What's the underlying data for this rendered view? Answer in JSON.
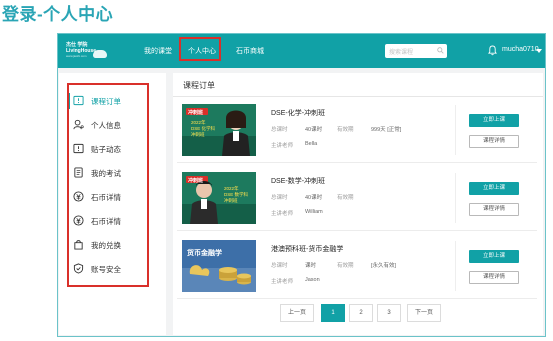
{
  "heading": "登录-个人中心",
  "colors": {
    "accent": "#11a1a6",
    "highlight": "#d9302a"
  },
  "logo": {
    "line1": "杰仕 学院",
    "line2": "LivingHouse",
    "sub": "www.jieshi.com"
  },
  "nav": {
    "items": [
      "我的课堂",
      "个人中心",
      "石币商城"
    ],
    "active": "个人中心"
  },
  "search": {
    "placeholder": "搜索课程"
  },
  "user": {
    "name": "mucha0710"
  },
  "sidebar": {
    "items": [
      {
        "label": "课程订单",
        "icon": "order-icon",
        "active": true
      },
      {
        "label": "个人信息",
        "icon": "user-icon",
        "active": false
      },
      {
        "label": "贴子动态",
        "icon": "post-icon",
        "active": false
      },
      {
        "label": "我的考试",
        "icon": "exam-icon",
        "active": false
      },
      {
        "label": "石币详情",
        "icon": "coin-icon",
        "active": false
      },
      {
        "label": "石币详情",
        "icon": "coin-icon",
        "active": false
      },
      {
        "label": "我的兑换",
        "icon": "exchange-icon",
        "active": false
      },
      {
        "label": "账号安全",
        "icon": "shield-icon",
        "active": false
      }
    ]
  },
  "main": {
    "title": "课程订单",
    "cards": [
      {
        "name": "DSE-化学-冲刺班",
        "hours_label": "总课时",
        "hours_value": "40课时",
        "valid_label": "有效期",
        "valid_value": "999天 [正常]",
        "teacher_label": "主讲老师",
        "teacher_value": "Bella",
        "thumb_tag": "冲刺班",
        "thumb_line1": "2022年",
        "thumb_line2": "DSE 化学科",
        "thumb_line3": "冲刺班",
        "enter_label": "立即上课",
        "detail_label": "课程详情"
      },
      {
        "name": "DSE-数学-冲刺班",
        "hours_label": "总课时",
        "hours_value": "40课时",
        "valid_label": "有效期",
        "valid_value": "",
        "teacher_label": "主讲老师",
        "teacher_value": "William",
        "thumb_tag": "冲刺班",
        "thumb_line1": "2022年",
        "thumb_line2": "DSE 数学科",
        "thumb_line3": "冲刺班",
        "enter_label": "立即上课",
        "detail_label": "课程详情"
      },
      {
        "name": "港澳预科班-货币金融学",
        "hours_label": "总课时",
        "hours_value": "课时",
        "valid_label": "有效期",
        "valid_value": "[永久有效]",
        "teacher_label": "主讲老师",
        "teacher_value": "Jason",
        "thumb_tag": "",
        "thumb_line1": "货币金融学",
        "thumb_line2": "",
        "thumb_line3": "",
        "enter_label": "立即上课",
        "detail_label": "课程详情"
      }
    ]
  },
  "pager": {
    "prev": "上一页",
    "pages": [
      "1",
      "2",
      "3"
    ],
    "current": "1",
    "next": "下一页"
  }
}
